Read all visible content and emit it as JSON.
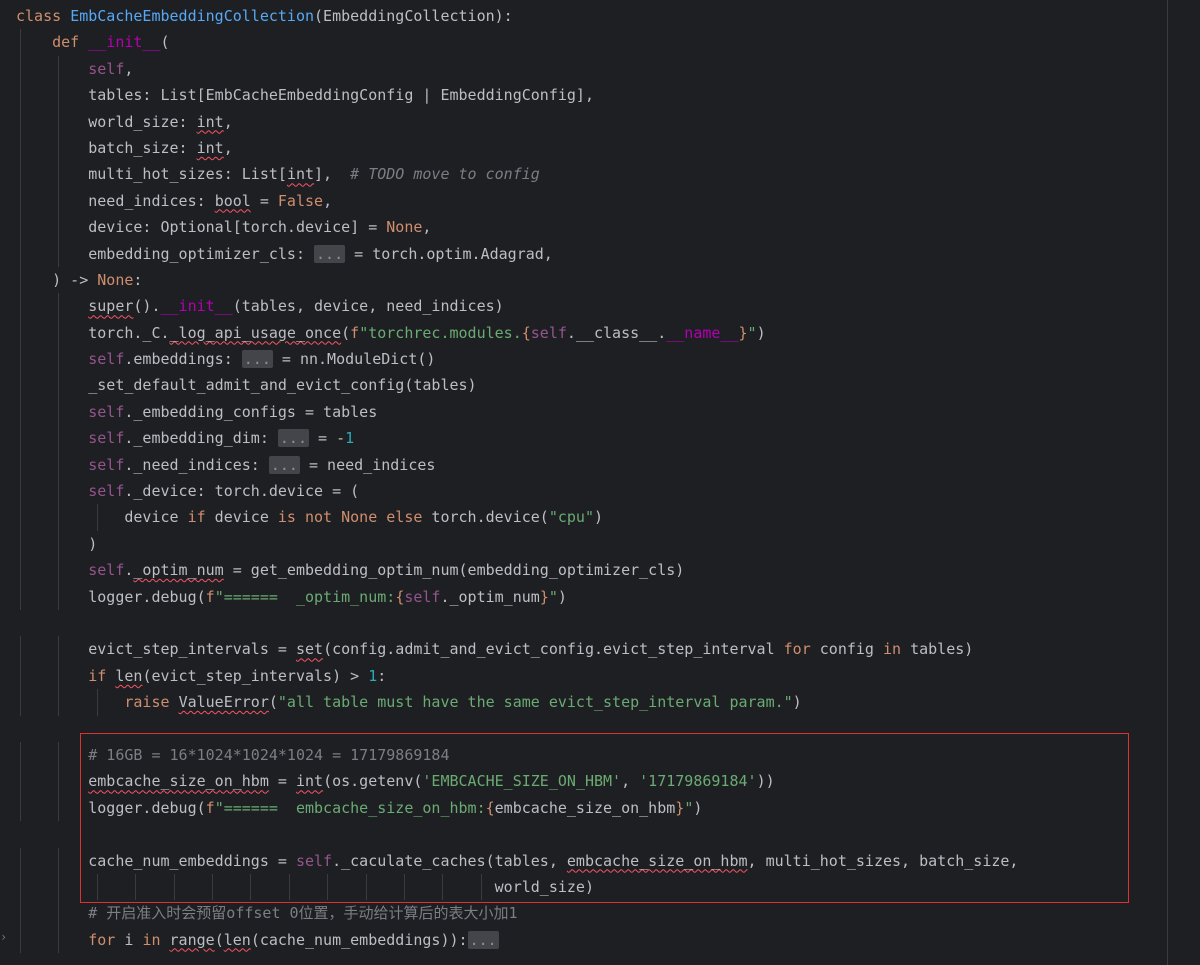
{
  "editor": {
    "theme": "dark",
    "highlight_color": "#e03131",
    "lines": [
      "class EmbCacheEmbeddingCollection(EmbeddingCollection):",
      "    def __init__(",
      "        self,",
      "        tables: List[EmbCacheEmbeddingConfig | EmbeddingConfig],",
      "        world_size: int,",
      "        batch_size: int,",
      "        multi_hot_sizes: List[int],  # TODO move to config",
      "        need_indices: bool = False,",
      "        device: Optional[torch.device] = None,",
      "        embedding_optimizer_cls: ... = torch.optim.Adagrad,",
      "    ) -> None:",
      "        super().__init__(tables, device, need_indices)",
      "        torch._C._log_api_usage_once(f\"torchrec.modules.{self.__class__.__name__}\")",
      "        self.embeddings: ... = nn.ModuleDict()",
      "        _set_default_admit_and_evict_config(tables)",
      "        self._embedding_configs = tables",
      "        self._embedding_dim: ... = -1",
      "        self._need_indices: ... = need_indices",
      "        self._device: torch.device = (",
      "            device if device is not None else torch.device(\"cpu\")",
      "        )",
      "        self._optim_num = get_embedding_optim_num(embedding_optimizer_cls)",
      "        logger.debug(f\"======  _optim_num:{self._optim_num}\")",
      "",
      "        evict_step_intervals = set(config.admit_and_evict_config.evict_step_interval for config in tables)",
      "        if len(evict_step_intervals) > 1:",
      "            raise ValueError(\"all table must have the same evict_step_interval param.\")",
      "",
      "        # 16GB = 16*1024*1024*1024 = 17179869184",
      "        embcache_size_on_hbm = int(os.getenv('EMBCACHE_SIZE_ON_HBM', '17179869184'))",
      "        logger.debug(f\"======  embcache_size_on_hbm:{embcache_size_on_hbm}\")",
      "",
      "        cache_num_embeddings = self._caculate_caches(tables, embcache_size_on_hbm, multi_hot_sizes, batch_size,",
      "                                                     world_size)",
      "        # 开启准入时会预留offset 0位置，手动给计算后的表大小加1",
      "        for i in range(len(cache_num_embeddings)):..."
    ]
  }
}
